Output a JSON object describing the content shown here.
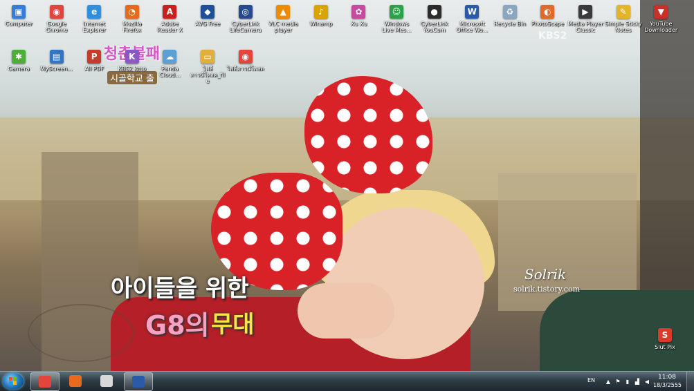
{
  "desktop": {
    "icons_row1": [
      {
        "label": "Computer",
        "icon": "computer-icon",
        "color": "#3a7bd5",
        "glyph": "▣"
      },
      {
        "label": "Google Chrome",
        "icon": "chrome-icon",
        "color": "#e2453c",
        "glyph": "◉"
      },
      {
        "label": "Internet Explorer",
        "icon": "ie-icon",
        "color": "#2e8fe0",
        "glyph": "e"
      },
      {
        "label": "Mozilla Firefox",
        "icon": "firefox-icon",
        "color": "#e86a1d",
        "glyph": "◔"
      },
      {
        "label": "Adobe Reader X",
        "icon": "adobe-reader-icon",
        "color": "#c8201e",
        "glyph": "A"
      },
      {
        "label": "AVG Free",
        "icon": "avg-icon",
        "color": "#1f4f99",
        "glyph": "◆"
      },
      {
        "label": "CyberLink LifeCamera",
        "icon": "cyberlink-icon",
        "color": "#264a8c",
        "glyph": "◎"
      },
      {
        "label": "VLC media player",
        "icon": "vlc-icon",
        "color": "#f08a00",
        "glyph": "▲"
      },
      {
        "label": "Winamp",
        "icon": "winamp-icon",
        "color": "#d9a300",
        "glyph": "♪"
      },
      {
        "label": "Xu Xu",
        "icon": "app-icon",
        "color": "#c84aa0",
        "glyph": "✿"
      },
      {
        "label": "Windows Live Mes...",
        "icon": "messenger-icon",
        "color": "#2fa04a",
        "glyph": "☺"
      },
      {
        "label": "CyberLink YouCam",
        "icon": "youcam-icon",
        "color": "#2b2b2b",
        "glyph": "●"
      },
      {
        "label": "Microsoft Office Wo...",
        "icon": "word-icon",
        "color": "#2b5aa8",
        "glyph": "W"
      },
      {
        "label": "Recycle Bin",
        "icon": "recycle-bin-icon",
        "color": "#8aa6c0",
        "glyph": "♻"
      },
      {
        "label": "PhotoScape",
        "icon": "photoscape-icon",
        "color": "#e06a2c",
        "glyph": "◐"
      },
      {
        "label": "Media Player Classic",
        "icon": "mpc-icon",
        "color": "#3a3a3a",
        "glyph": "▶"
      },
      {
        "label": "Simple Sticky Notes",
        "icon": "sticky-notes-icon",
        "color": "#e4b42a",
        "glyph": "✎"
      },
      {
        "label": "YouTube Downloader",
        "icon": "youtube-downloader-icon",
        "color": "#c9302c",
        "glyph": "▼"
      }
    ],
    "icons_row2": [
      {
        "label": "Camera",
        "icon": "camera-icon",
        "color": "#4fae3a",
        "glyph": "✱"
      },
      {
        "label": "MyScreen...",
        "icon": "screen-recorder-icon",
        "color": "#3474c4",
        "glyph": "▤"
      },
      {
        "label": "All PDF",
        "icon": "pdf-icon",
        "color": "#c43c2c",
        "glyph": "P"
      },
      {
        "label": "KBS2 kmo",
        "icon": "app-icon",
        "color": "#8a58c4",
        "glyph": "K"
      },
      {
        "label": "Panda Cloud...",
        "icon": "panda-icon",
        "color": "#5aa0d4",
        "glyph": "☁"
      },
      {
        "label": "ไฟล์ดาวน์โหลด_file",
        "icon": "folder-icon",
        "color": "#e0b03a",
        "glyph": "▭"
      },
      {
        "label": "ไฟล์ดาวน์โหลด",
        "icon": "chrome-icon",
        "color": "#e2453c",
        "glyph": "◉"
      }
    ],
    "icon_right": {
      "label": "Slut Pix",
      "icon": "app-icon",
      "color": "#d93a2a",
      "glyph": "S"
    },
    "wallpaper": {
      "caption_line1": "아이들을 위한",
      "caption_line2a": "G8의",
      "caption_line2b": "무대",
      "signature": "Solrik",
      "url": "solrik.tistory.com",
      "broadcaster": "KBS2",
      "logo_top": "청춘불패",
      "logo_bottom": "시골학교 출"
    }
  },
  "taskbar": {
    "start_label": "Start",
    "pinned": [
      {
        "name": "chrome",
        "icon": "chrome-icon",
        "active": true,
        "color": "#e2453c"
      },
      {
        "name": "firefox",
        "icon": "firefox-icon",
        "active": false,
        "color": "#e86a1d"
      },
      {
        "name": "photo",
        "icon": "picture-icon",
        "active": false,
        "color": "#d8d8d8"
      },
      {
        "name": "word",
        "icon": "word-icon",
        "active": true,
        "color": "#2b5aa8"
      }
    ],
    "tray": {
      "language": "EN",
      "time": "11:08",
      "date": "18/3/2555"
    }
  }
}
